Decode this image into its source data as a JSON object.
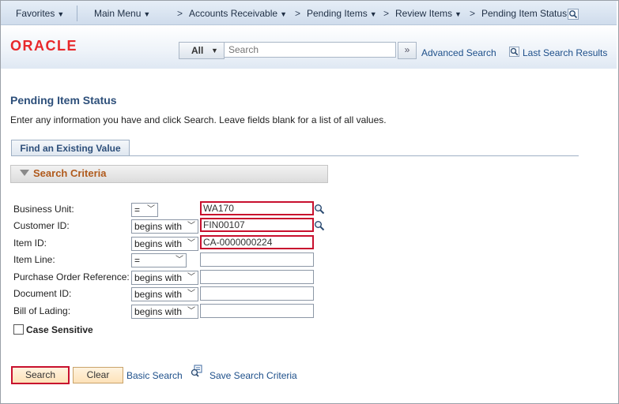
{
  "nav": {
    "favorites": "Favorites",
    "main_menu": "Main Menu",
    "breadcrumb": [
      "Accounts Receivable",
      "Pending Items",
      "Review Items",
      "Pending Item Status"
    ],
    "separator": ">",
    "dropdown_glyph": "▼"
  },
  "header": {
    "logo": "ORACLE",
    "search_scope": "All",
    "search_placeholder": "Search",
    "go_glyph": "»",
    "advanced_search": "Advanced Search",
    "last_search_results": "Last Search Results"
  },
  "page": {
    "title": "Pending Item Status",
    "instructions": "Enter any information you have and click Search. Leave fields blank for a list of all values.",
    "tab": "Find an Existing Value",
    "criteria_title": "Search Criteria"
  },
  "fields": [
    {
      "label": "Business Unit:",
      "operator": "=",
      "value": "WA170",
      "highlighted": true,
      "lookup": true
    },
    {
      "label": "Customer ID:",
      "operator": "begins with",
      "value": "FIN00107",
      "highlighted": true,
      "lookup": true
    },
    {
      "label": "Item ID:",
      "operator": "begins with",
      "value": "CA-0000000224",
      "highlighted": true,
      "lookup": false
    },
    {
      "label": "Item Line:",
      "operator": "=",
      "value": "",
      "highlighted": false,
      "lookup": false
    },
    {
      "label": "Purchase Order Reference:",
      "operator": "begins with",
      "value": "",
      "highlighted": false,
      "lookup": false
    },
    {
      "label": "Document ID:",
      "operator": "begins with",
      "value": "",
      "highlighted": false,
      "lookup": false
    },
    {
      "label": "Bill of Lading:",
      "operator": "begins with",
      "value": "",
      "highlighted": false,
      "lookup": false
    }
  ],
  "case_sensitive": {
    "label": "Case Sensitive",
    "checked": false
  },
  "actions": {
    "search": "Search",
    "clear": "Clear",
    "basic_search": "Basic Search",
    "save_search": "Save Search Criteria"
  },
  "colors": {
    "highlight": "#c8102e",
    "link": "#1d4f8a",
    "title": "#2d4f7a",
    "criteria_title": "#b05a1c",
    "logo": "#e8282b"
  }
}
